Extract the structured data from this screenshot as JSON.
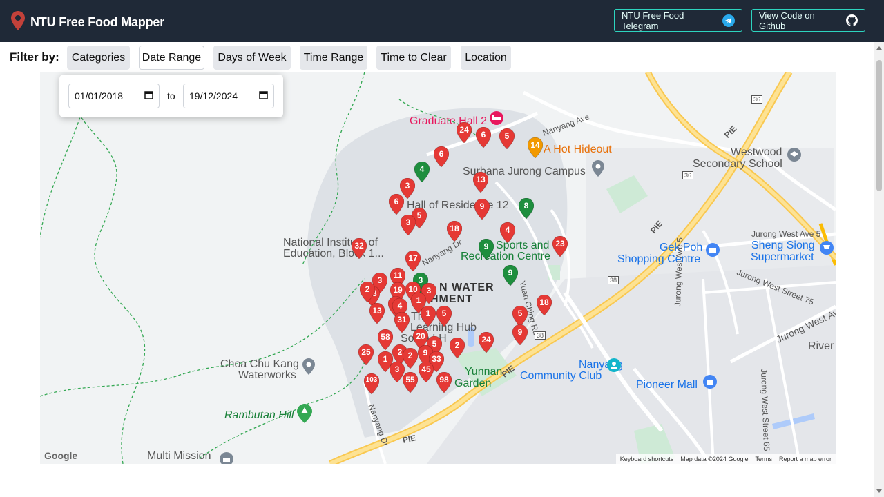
{
  "app": {
    "title": "NTU Free Food Mapper",
    "telegram_button": "NTU Free Food Telegram",
    "github_button": "View Code on Github"
  },
  "filters": {
    "label": "Filter by:",
    "chips": [
      "Categories",
      "Date Range",
      "Days of Week",
      "Time Range",
      "Time to Clear",
      "Location"
    ],
    "active": "Date Range"
  },
  "date_range": {
    "from": "01/01/2018",
    "to_label": "to",
    "to": "19/12/2024"
  },
  "map": {
    "places": {
      "graduate_hall": "Graduate Hall 2",
      "hot_hideout": "A Hot Hideout",
      "surbana": "Surbana Jurong Campus",
      "westwood_1": "Westwood",
      "westwood_2": "Secondary School",
      "hall_12": "Hall of Residence 12",
      "nie_1": "National Institute of",
      "nie_2": "Education, Block 1...",
      "src_1": "Sports and",
      "src_2": "Recreation Centre",
      "gek_poh_1": "Gek Poh",
      "gek_poh_2": "Shopping Centre",
      "sheng_siong_1": "Sheng Siong",
      "sheng_siong_2": "Supermarket",
      "catchment_1": "N WATER",
      "catchment_2": "HMENT",
      "learning_hub_1": "The",
      "learning_hub_2": "Learning Hub",
      "learning_hub_3": "South LH",
      "choa_1": "Choa Chu Kang",
      "choa_2": "Waterworks",
      "yunnan_1": "Yunnan",
      "yunnan_2": "Garden",
      "nanyang_cc_1": "Nanyang",
      "nanyang_cc_2": "Community Club",
      "pioneer": "Pioneer Mall",
      "rambutan": "Rambutan Hill",
      "multi_mission": "Multi Mission",
      "river": "River"
    },
    "roads": {
      "nanyang_ave": "Nanyang Ave",
      "pie_1": "PIE",
      "pie_2": "PIE",
      "pie_3": "PIE",
      "pie_4": "PIE",
      "jurong_west_ave5": "Jurong West Ave 5",
      "jurong_west_75": "Jurong West Street 75",
      "jurong_west_ave": "Jurong West Av",
      "jurong_west_ave5_v": "Jurong West Ave 5",
      "jurong_west_65": "Jurong West Street 65",
      "nanyang_dr": "Nanyang Dr",
      "nanyang_dr2": "Nanyang Dr",
      "yuan_ching": "Yuan Ching Rd",
      "r36a": "36",
      "r36b": "36",
      "r38a": "38",
      "r38b": "38"
    },
    "markers": [
      {
        "label": "24",
        "color": "red"
      },
      {
        "label": "6",
        "color": "red"
      },
      {
        "label": "5",
        "color": "red"
      },
      {
        "label": "14",
        "color": "orange"
      },
      {
        "label": "6",
        "color": "red"
      },
      {
        "label": "4",
        "color": "green"
      },
      {
        "label": "13",
        "color": "red"
      },
      {
        "label": "3",
        "color": "red"
      },
      {
        "label": "6",
        "color": "red"
      },
      {
        "label": "9",
        "color": "red"
      },
      {
        "label": "8",
        "color": "green"
      },
      {
        "label": "5",
        "color": "red"
      },
      {
        "label": "3",
        "color": "red"
      },
      {
        "label": "18",
        "color": "red"
      },
      {
        "label": "4",
        "color": "red"
      },
      {
        "label": "32",
        "color": "red"
      },
      {
        "label": "9",
        "color": "green"
      },
      {
        "label": "23",
        "color": "red"
      },
      {
        "label": "17",
        "color": "red"
      },
      {
        "label": "9",
        "color": "green"
      },
      {
        "label": "3",
        "color": "green"
      },
      {
        "label": "11",
        "color": "red"
      },
      {
        "label": "3",
        "color": "red"
      },
      {
        "label": "13",
        "color": "red"
      },
      {
        "label": "2",
        "color": "red"
      },
      {
        "label": "19",
        "color": "red"
      },
      {
        "label": "10",
        "color": "red"
      },
      {
        "label": "3",
        "color": "red"
      },
      {
        "label": "1",
        "color": "red"
      },
      {
        "label": "13",
        "color": "red"
      },
      {
        "label": "5",
        "color": "red"
      },
      {
        "label": "4",
        "color": "red"
      },
      {
        "label": "1",
        "color": "red"
      },
      {
        "label": "5",
        "color": "red"
      },
      {
        "label": "31",
        "color": "red"
      },
      {
        "label": "18",
        "color": "red"
      },
      {
        "label": "5",
        "color": "red"
      },
      {
        "label": "9",
        "color": "red"
      },
      {
        "label": "20",
        "color": "red"
      },
      {
        "label": "58",
        "color": "red"
      },
      {
        "label": "24",
        "color": "red"
      },
      {
        "label": "5",
        "color": "red"
      },
      {
        "label": "2",
        "color": "red"
      },
      {
        "label": "25",
        "color": "red"
      },
      {
        "label": "2",
        "color": "red"
      },
      {
        "label": "9",
        "color": "red"
      },
      {
        "label": "2",
        "color": "red"
      },
      {
        "label": "1",
        "color": "red"
      },
      {
        "label": "33",
        "color": "red"
      },
      {
        "label": "3",
        "color": "red"
      },
      {
        "label": "45",
        "color": "red"
      },
      {
        "label": "55",
        "color": "red"
      },
      {
        "label": "98",
        "color": "red"
      },
      {
        "label": "103",
        "color": "red"
      }
    ],
    "attribution": {
      "keyboard": "Keyboard shortcuts",
      "data": "Map data ©2024 Google",
      "terms": "Terms",
      "report": "Report a map error"
    },
    "logo": "Google"
  },
  "colors": {
    "header_bg": "#1f2937",
    "accent": "#2dd4bf",
    "marker_red": "#e53935",
    "marker_green": "#1e8e3e",
    "marker_orange": "#f29900"
  }
}
